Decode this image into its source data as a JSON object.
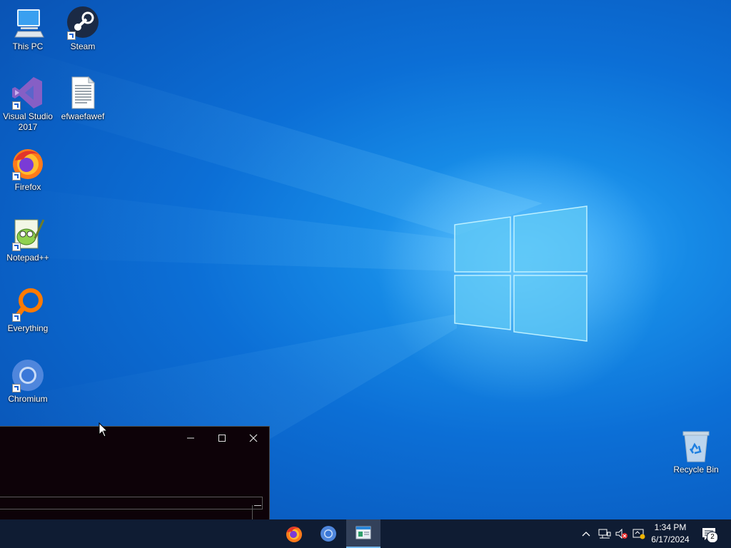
{
  "desktop": {
    "icons": [
      {
        "label": "This PC",
        "icon": "computer-icon"
      },
      {
        "label": "Steam",
        "icon": "steam-icon"
      },
      {
        "label": "Visual Studio 2017",
        "icon": "visual-studio-icon"
      },
      {
        "label": "efwaefawef",
        "icon": "text-file-icon"
      },
      {
        "label": "Firefox",
        "icon": "firefox-icon"
      },
      {
        "label": "Notepad++",
        "icon": "notepad-plus-plus-icon"
      },
      {
        "label": "Everything",
        "icon": "everything-search-icon"
      },
      {
        "label": "Chromium",
        "icon": "chromium-icon"
      },
      {
        "label": "Recycle Bin",
        "icon": "recycle-bin-icon"
      }
    ]
  },
  "window": {
    "minimize_icon": "minimize-icon",
    "maximize_icon": "maximize-icon",
    "close_icon": "close-icon"
  },
  "taskbar": {
    "apps": [
      {
        "name": "Firefox",
        "icon": "firefox-icon"
      },
      {
        "name": "Chromium",
        "icon": "chromium-icon"
      },
      {
        "name": "Window",
        "icon": "window-app-icon",
        "active": true
      }
    ],
    "tray": {
      "time": "1:34 PM",
      "date": "6/17/2024",
      "notification_count": "2"
    }
  },
  "colors": {
    "taskbar": "#0f1c33",
    "accent": "#0078d7",
    "window_bg": "#0d0208"
  }
}
